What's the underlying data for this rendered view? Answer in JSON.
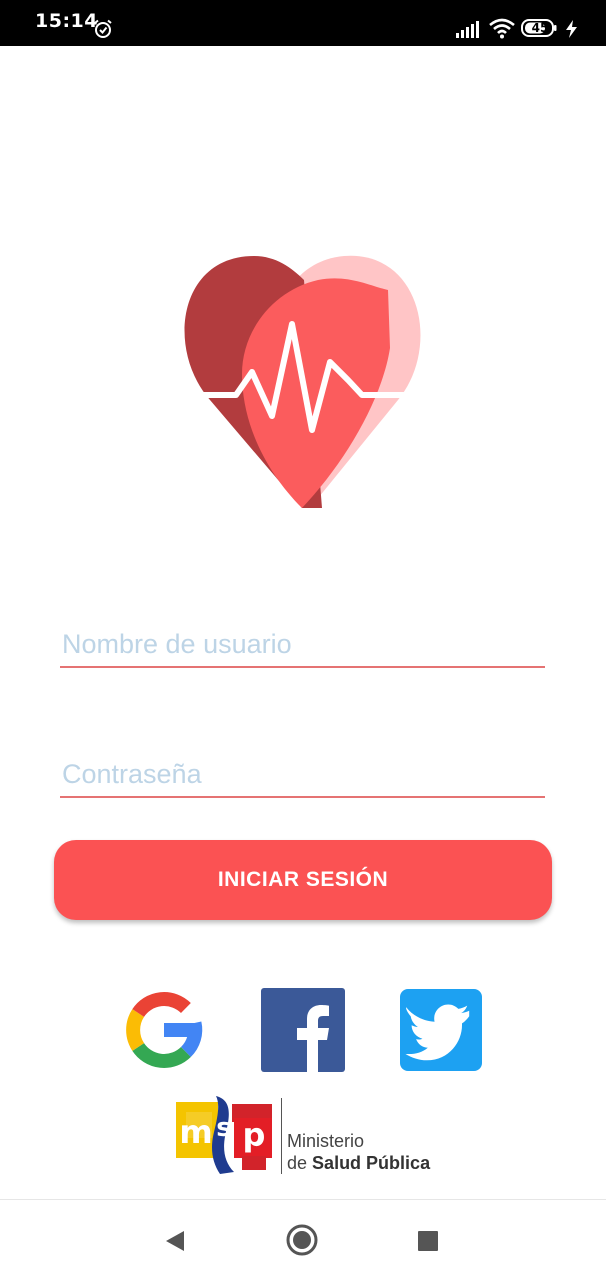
{
  "status_bar": {
    "time": "15:14",
    "battery_level": "45",
    "icons": [
      "alarm-icon",
      "signal-icon",
      "wifi-icon",
      "battery-icon",
      "charging-bolt-icon"
    ]
  },
  "logo": {
    "icon": "heart-pulse-icon",
    "colors": {
      "dark": "#b23c3e",
      "mid": "#fb5c5d",
      "light": "#ffc5c6"
    }
  },
  "login_form": {
    "username_placeholder": "Nombre de usuario",
    "password_placeholder": "Contraseña",
    "username_value": "",
    "password_value": "",
    "submit_label": "INICIAR SESIÓN"
  },
  "social": {
    "google": "google-icon",
    "facebook": "facebook-icon",
    "twitter": "twitter-icon"
  },
  "sponsor": {
    "logo_text": "mSp",
    "line1": "Ministerio",
    "line2_prefix": "de",
    "line2_bold": "Salud Pública"
  },
  "nav_bar": {
    "icons": [
      "back-icon",
      "home-icon",
      "recents-icon"
    ]
  },
  "colors": {
    "accent": "#fb5253",
    "underline": "#e57373",
    "placeholder": "#bdd4e6",
    "facebook": "#3b5998",
    "twitter": "#1da1f2"
  }
}
